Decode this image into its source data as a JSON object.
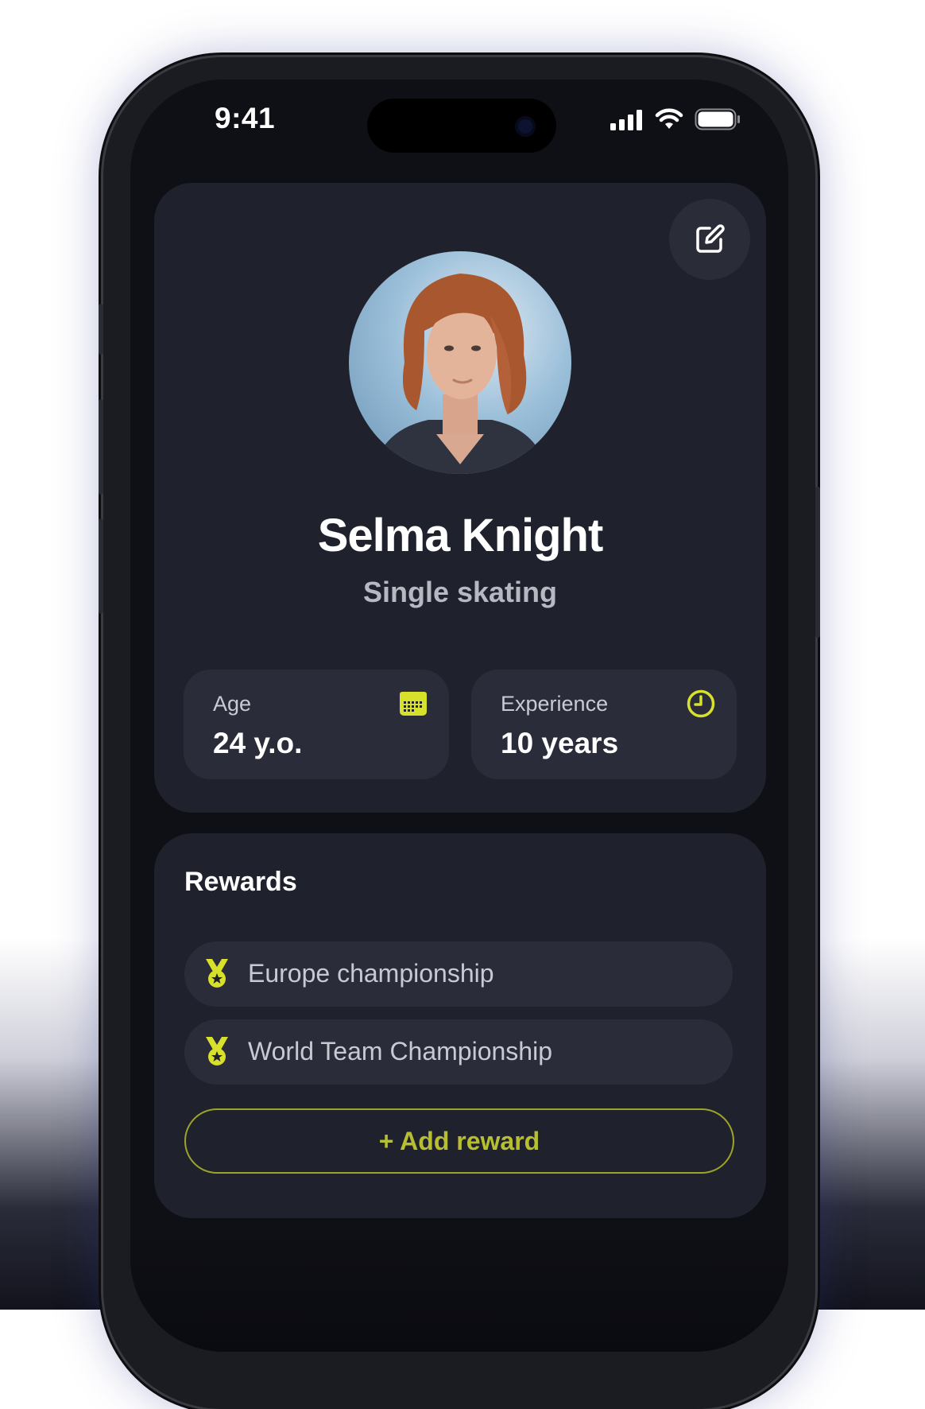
{
  "status_bar": {
    "time": "9:41"
  },
  "profile": {
    "name": "Selma Knight",
    "discipline": "Single skating",
    "edit_icon": "edit-square-icon",
    "stats": [
      {
        "label": "Age",
        "value": "24 y.o.",
        "icon": "calendar-icon"
      },
      {
        "label": "Experience",
        "value": "10 years",
        "icon": "clock-icon"
      }
    ]
  },
  "rewards": {
    "title": "Rewards",
    "items": [
      {
        "label": "Europe championship",
        "icon": "medal-icon"
      },
      {
        "label": "World Team Championship",
        "icon": "medal-icon"
      }
    ],
    "add_label": "+ Add reward"
  },
  "colors": {
    "accent": "#d7e02a",
    "card": "#1f212c",
    "tile": "#2a2c3a",
    "background": "#0f1016"
  }
}
